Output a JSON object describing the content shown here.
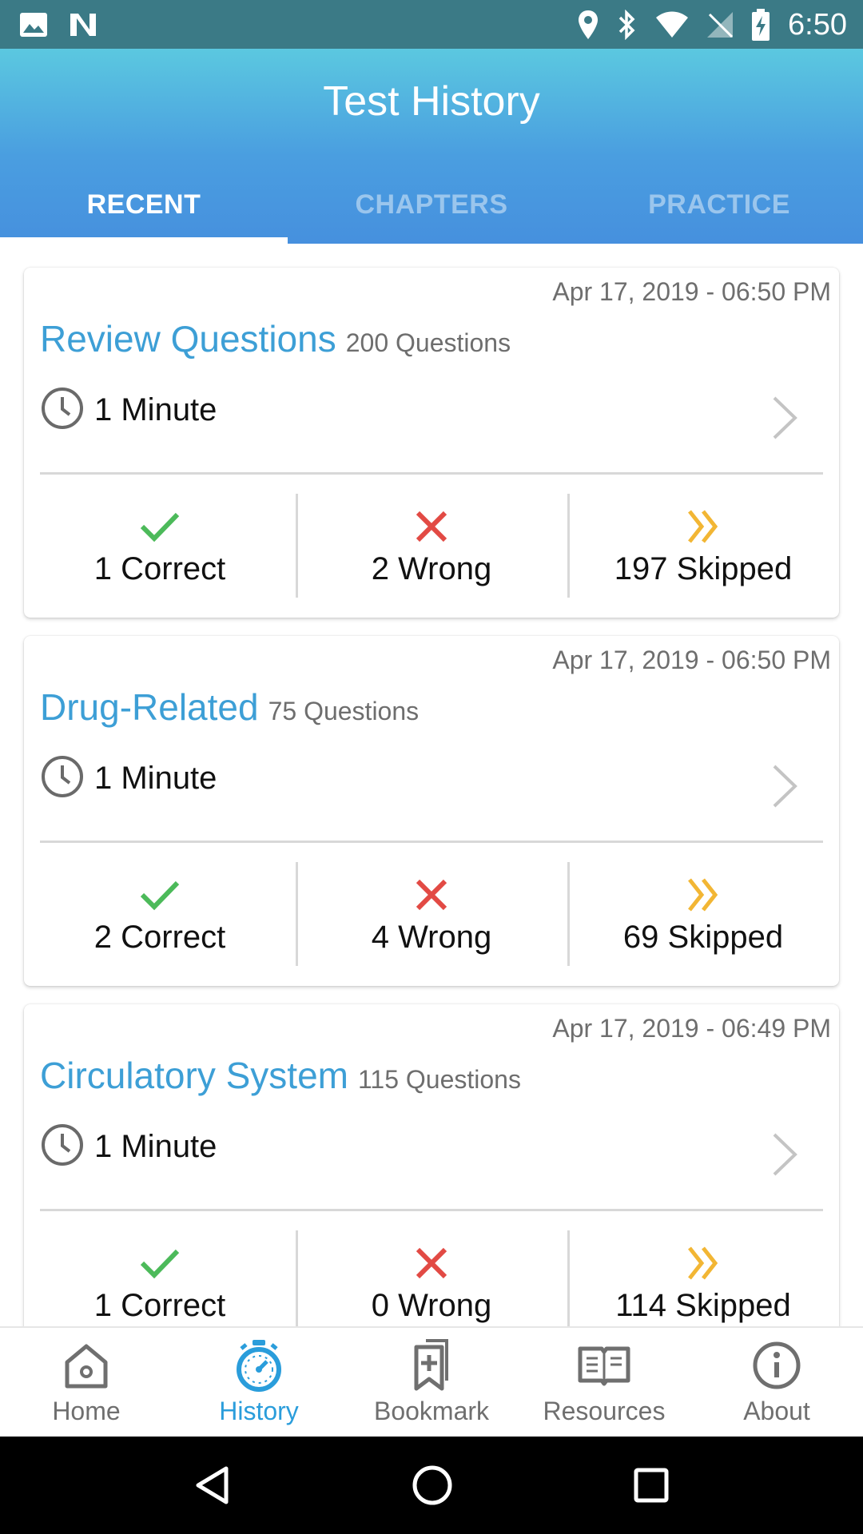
{
  "status_bar": {
    "time": "6:50",
    "icons_left": [
      "image-icon",
      "n-icon"
    ],
    "icons_right": [
      "location-icon",
      "bluetooth-icon",
      "wifi-icon",
      "no-sim-icon",
      "battery-charging-icon"
    ]
  },
  "header": {
    "title": "Test History",
    "tabs": [
      {
        "label": "RECENT",
        "active": true
      },
      {
        "label": "CHAPTERS",
        "active": false
      },
      {
        "label": "PRACTICE",
        "active": false
      }
    ]
  },
  "cards": [
    {
      "date": "Apr 17, 2019 - 06:50 PM",
      "title": "Review Questions",
      "question_count": "200 Questions",
      "duration": "1 Minute",
      "correct": "1 Correct",
      "wrong": "2 Wrong",
      "skipped": "197 Skipped"
    },
    {
      "date": "Apr 17, 2019 - 06:50 PM",
      "title": "Drug-Related",
      "question_count": "75 Questions",
      "duration": "1 Minute",
      "correct": "2 Correct",
      "wrong": "4 Wrong",
      "skipped": "69 Skipped"
    },
    {
      "date": "Apr 17, 2019 - 06:49 PM",
      "title": "Circulatory System",
      "question_count": "115 Questions",
      "duration": "1 Minute",
      "correct": "1 Correct",
      "wrong": "0 Wrong",
      "skipped": "114 Skipped"
    }
  ],
  "bottom_nav": [
    {
      "label": "Home",
      "icon": "home-icon",
      "active": false
    },
    {
      "label": "History",
      "icon": "stopwatch-icon",
      "active": true
    },
    {
      "label": "Bookmark",
      "icon": "bookmark-add-icon",
      "active": false
    },
    {
      "label": "Resources",
      "icon": "book-icon",
      "active": false
    },
    {
      "label": "About",
      "icon": "info-icon",
      "active": false
    }
  ],
  "colors": {
    "accent": "#3d9fd6",
    "status_bar": "#3b7a86",
    "header_top": "#5bc8e0",
    "header_bottom": "#4690de",
    "correct": "#4cba5a",
    "wrong": "#e24a44",
    "skipped": "#f2b634",
    "nav_active": "#2a9ddb"
  }
}
